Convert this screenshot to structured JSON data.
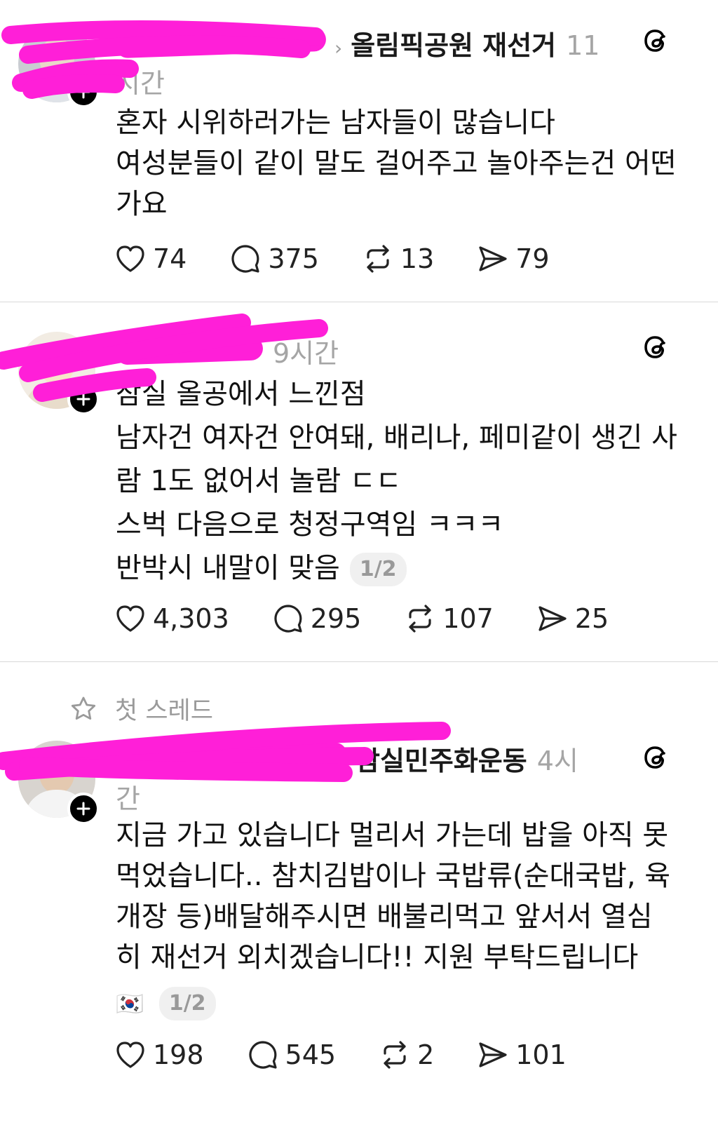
{
  "colors": {
    "redaction": "#ff1fd8",
    "muted_text": "#a5a5a5",
    "divider": "#d9d9d9"
  },
  "posts": [
    {
      "topic": "올림픽공원 재선거",
      "time": "11시간",
      "time_a": "11",
      "time_b": "시간",
      "lines": [
        "혼자 시위하러가는 남자들이 많습니다",
        "여성분들이 같이 말도 걸어주고 놀아주는건 어떤",
        "가요"
      ],
      "likes": "74",
      "comments": "375",
      "reposts": "13",
      "shares": "79"
    },
    {
      "time": "9시간",
      "lines": [
        "잠실 올공에서 느낀점",
        "남자건 여자건 안여돼, 배리나, 페미같이 생긴 사",
        "람 1도 없어서 놀람 ㄷㄷ",
        "스벅 다음으로 청정구역임 ㅋㅋㅋ",
        "반박시 내말이 맞음"
      ],
      "page": "1/2",
      "likes": "4,303",
      "comments": "295",
      "reposts": "107",
      "shares": "25"
    },
    {
      "label": "첫 스레드",
      "topic": "잠실민주화운동",
      "time_a": "4시",
      "time_b": "간",
      "lines": [
        "지금 가고 있습니다 멀리서 가는데 밥을 아직 못",
        "먹었습니다.. 참치김밥이나 국밥류(순대국밥, 육",
        "개장 등)배달해주시면 배불리먹고 앞서서 열심",
        "히 재선거 외치겠습니다!! 지원 부탁드립니다"
      ],
      "flag": "🇰🇷",
      "page": "1/2",
      "likes": "198",
      "comments": "545",
      "reposts": "2",
      "shares": "101"
    }
  ]
}
